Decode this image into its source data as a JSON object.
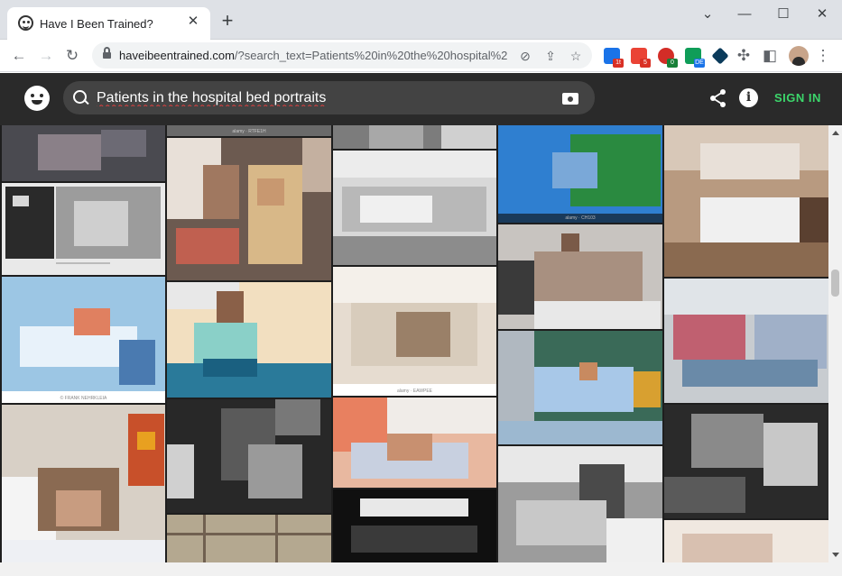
{
  "browser": {
    "tab_title": "Have I Been Trained?",
    "url_host": "haveibeentrained.com",
    "url_path": "/?search_text=Patients%20in%20the%20hospital%2...",
    "extensions": [
      {
        "name": "ext-calendar-icon",
        "color": "#1a73e8",
        "badge": "1t",
        "badge_color": "#d93025"
      },
      {
        "name": "ext-gmail-icon",
        "color": "#ea4335",
        "badge": "5",
        "badge_color": "#d93025"
      },
      {
        "name": "ext-lastpass-icon",
        "color": "#d32d27",
        "badge": "0",
        "badge_color": "#188038"
      },
      {
        "name": "ext-dashlane-icon",
        "color": "#0f9d58",
        "badge": "DE",
        "badge_color": "#1a73e8"
      },
      {
        "name": "ext-shield-icon",
        "color": "#0b3b5b",
        "badge": "",
        "badge_color": ""
      }
    ]
  },
  "site": {
    "search_value": "Patients in the hospital bed portraits",
    "signin_label": "SIGN IN"
  },
  "grid": {
    "captions": [
      "alamy · RTFE1H",
      "alamy · CH103",
      "alamy · EAWPEE",
      "© FRANK NEHRKLEIA"
    ]
  }
}
